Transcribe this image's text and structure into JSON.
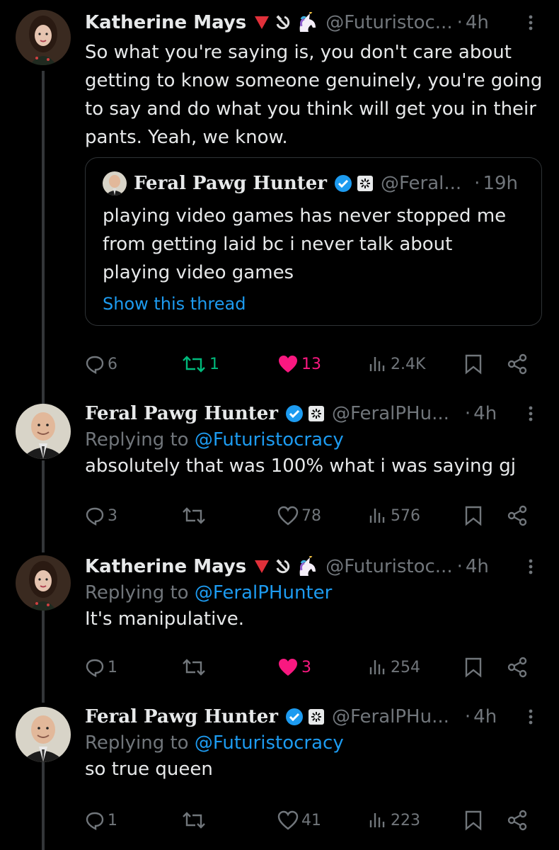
{
  "tweets": [
    {
      "name": "Katherine Mays",
      "handle": "@Futuristoc...",
      "dot": "·",
      "time": "4h",
      "replying_prefix": "",
      "replying_to": "",
      "text": "So what you're saying is, you don't care about getting to know someone genuinely, you're going to say and do what you think will get you in their pants. Yeah, we know.",
      "quote": {
        "name": "Feral Pawg Hunter",
        "handle": "@Feral...",
        "dot": "·",
        "time": "19h",
        "text": "playing video games has never stopped me from getting laid bc i never talk about playing video games",
        "show_thread": "Show this thread"
      },
      "replies": "6",
      "retweets": "1",
      "likes": "13",
      "views": "2.4K",
      "liked": true,
      "retweeted": true
    },
    {
      "name": "Feral Pawg Hunter",
      "handle": "@FeralPHu...",
      "dot": "·",
      "time": "4h",
      "replying_prefix": "Replying to",
      "replying_to": "@Futuristocracy",
      "text": "absolutely that was 100% what i was saying gj",
      "replies": "3",
      "retweets": "",
      "likes": "78",
      "views": "576",
      "liked": false,
      "retweeted": false
    },
    {
      "name": "Katherine Mays",
      "handle": "@Futuristoc...",
      "dot": "·",
      "time": "4h",
      "replying_prefix": "Replying to",
      "replying_to": "@FeralPHunter",
      "text": "It's manipulative.",
      "replies": "1",
      "retweets": "",
      "likes": "3",
      "views": "254",
      "liked": true,
      "retweeted": false
    },
    {
      "name": "Feral Pawg Hunter",
      "handle": "@FeralPHu...",
      "dot": "·",
      "time": "4h",
      "replying_prefix": "Replying to",
      "replying_to": "@Futuristocracy",
      "text": "so true queen",
      "replies": "1",
      "retweets": "",
      "likes": "41",
      "views": "223",
      "liked": false,
      "retweeted": false
    }
  ],
  "colors": {
    "background": "#000000",
    "text": "#e7e9ea",
    "muted": "#71767b",
    "link": "#1d9bf0",
    "like_active": "#f91880",
    "retweet_active": "#00ba7c",
    "verified": "#1d9bf0"
  },
  "icons": [
    "reply-icon",
    "retweet-icon",
    "heart-icon",
    "views-icon",
    "bookmark-icon",
    "share-icon",
    "more-icon",
    "verified-badge-icon",
    "triangle-emoji-icon",
    "hammer-sickle-emoji-icon",
    "unicorn-emoji-icon",
    "sparkle-badge-icon"
  ]
}
